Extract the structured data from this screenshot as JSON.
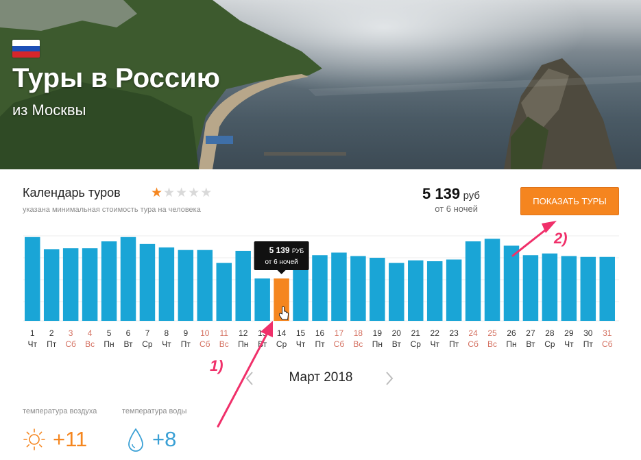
{
  "hero": {
    "title": "Туры в Россию",
    "subtitle": "из Москвы",
    "flag": "russia-flag"
  },
  "calendar": {
    "title": "Календарь туров",
    "rating_stars": 1,
    "rating_max": 5,
    "note": "указана минимальная стоимость тура на человека",
    "min_price": "5 139",
    "currency": "руб",
    "nights": "от 6 ночей",
    "show_button": "ПОКАЗАТЬ ТУРЫ",
    "month": "Март 2018",
    "prev_icon": "chevron-left-icon",
    "next_icon": "chevron-right-icon"
  },
  "tooltip": {
    "price": "5 139",
    "currency": "РУБ",
    "nights": "от 6 ночей",
    "day": 14
  },
  "colors": {
    "bar": "#1aa5d6",
    "bar_selected": "#f5861f",
    "accent": "#f5851f",
    "weekend_text": "#d47060",
    "annotation": "#f0306a"
  },
  "annotations": [
    {
      "label": "1)",
      "points_to": "day-14-bar"
    },
    {
      "label": "2)",
      "points_to": "show-tours-button"
    }
  ],
  "weather": {
    "air_label": "температура воздуха",
    "water_label": "температура воды",
    "air_value": "+11",
    "water_value": "+8",
    "air_icon": "sun-icon",
    "water_icon": "water-drop-icon"
  },
  "chart_data": {
    "type": "bar",
    "categories": [
      "1",
      "2",
      "3",
      "4",
      "5",
      "6",
      "7",
      "8",
      "9",
      "10",
      "11",
      "12",
      "13",
      "14",
      "15",
      "16",
      "17",
      "18",
      "19",
      "20",
      "21",
      "22",
      "23",
      "24",
      "25",
      "26",
      "27",
      "28",
      "29",
      "30",
      "31"
    ],
    "weekdays": [
      "Чт",
      "Пт",
      "Сб",
      "Вс",
      "Пн",
      "Вт",
      "Ср",
      "Чт",
      "Пт",
      "Сб",
      "Вс",
      "Пн",
      "Вт",
      "Ср",
      "Чт",
      "Пт",
      "Сб",
      "Вс",
      "Пн",
      "Вт",
      "Ср",
      "Чт",
      "Пт",
      "Сб",
      "Вс",
      "Пн",
      "Вт",
      "Ср",
      "Чт",
      "Пт",
      "Сб"
    ],
    "weekend": [
      false,
      false,
      true,
      true,
      false,
      false,
      false,
      false,
      false,
      true,
      true,
      false,
      false,
      false,
      false,
      false,
      true,
      true,
      false,
      false,
      false,
      false,
      false,
      true,
      true,
      false,
      false,
      false,
      false,
      false,
      true
    ],
    "values": [
      97,
      83,
      84,
      84,
      92,
      97,
      89,
      85,
      82,
      82,
      67,
      81,
      49,
      49,
      84,
      76,
      79,
      75,
      73,
      67,
      70,
      69,
      71,
      92,
      95,
      87,
      76,
      78,
      75,
      74,
      74
    ],
    "value_unit": "relative min price (no scale shown)",
    "selected_index": 13,
    "ylim": [
      0,
      100
    ],
    "grid": true
  }
}
